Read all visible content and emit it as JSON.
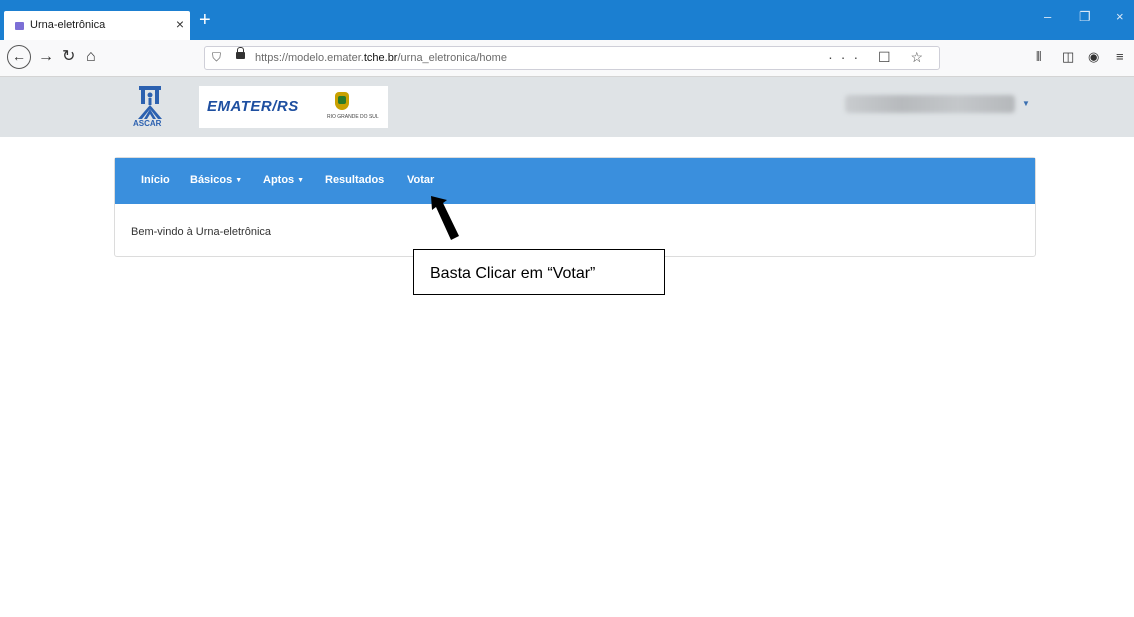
{
  "browser": {
    "tab_title": "Urna-eletrônica",
    "tab_close": "×",
    "new_tab": "+",
    "url_prefix": "https://modelo.emater.",
    "url_domain": "tche.br",
    "url_path": "/urna_eletronica/home",
    "url_actions": "··· ☐ ☆",
    "icons": {
      "back": "back-arrow-icon",
      "forward": "forward-arrow-icon",
      "reload": "reload-icon",
      "home": "home-icon",
      "shield": "tracking-shield-icon",
      "lock": "lock-icon",
      "library": "library-icon",
      "sidebar": "sidebar-icon",
      "account": "account-icon",
      "menu": "hamburger-menu-icon"
    },
    "window_controls": {
      "minimize": "–",
      "restore": "❐",
      "close": "×"
    }
  },
  "header": {
    "ascar_logo_text": "ASCAR",
    "emater_logo_text": "EMATER/RS",
    "emater_small_text": "RIO GRANDE DO SUL",
    "user_name_redacted": ""
  },
  "menu": {
    "items": [
      {
        "label": "Início",
        "dropdown": false
      },
      {
        "label": "Básicos",
        "dropdown": true
      },
      {
        "label": "Aptos",
        "dropdown": true
      },
      {
        "label": "Resultados",
        "dropdown": false
      },
      {
        "label": "Votar",
        "dropdown": false
      }
    ],
    "caret": "▼"
  },
  "content": {
    "welcome": "Bem-vindo à Urna-eletrônica"
  },
  "annotation": {
    "callout": "Basta Clicar em “Votar”"
  },
  "colors": {
    "tabbar": "#1b7fd1",
    "menu_bar": "#3a8fdd",
    "header_bg": "#dfe3e6"
  }
}
